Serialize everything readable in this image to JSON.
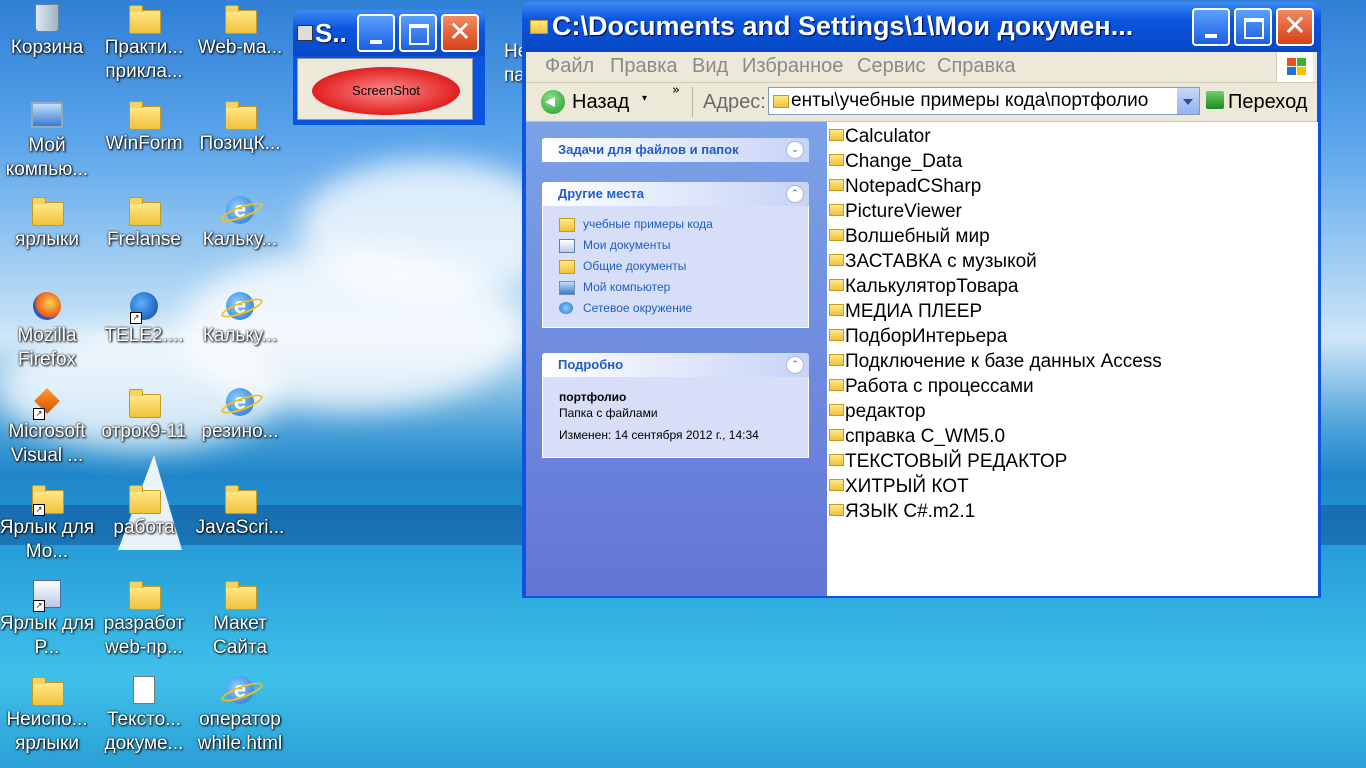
{
  "desktop": {
    "icons": [
      {
        "label": "Корзина",
        "icon": "recycle-bin-icon"
      },
      {
        "label": "Практи... прикла...",
        "icon": "folder-icon"
      },
      {
        "label": "Web-ма...",
        "icon": "folder-icon"
      },
      {
        "label": "Мой компью...",
        "icon": "my-computer-icon"
      },
      {
        "label": "WinForm",
        "icon": "folder-icon"
      },
      {
        "label": "ПозицК...",
        "icon": "folder-icon"
      },
      {
        "label": "ярлыки",
        "icon": "folder-icon"
      },
      {
        "label": "Frelanse",
        "icon": "folder-icon"
      },
      {
        "label": "Кальку...",
        "icon": "internet-explorer-icon"
      },
      {
        "label": "Mozilla Firefox",
        "icon": "firefox-icon"
      },
      {
        "label": "TELE2....",
        "icon": "tele2-icon"
      },
      {
        "label": "Кальку...",
        "icon": "internet-explorer-icon"
      },
      {
        "label": "Microsoft Visual ...",
        "icon": "visual-studio-icon"
      },
      {
        "label": "отрок9-11",
        "icon": "folder-icon"
      },
      {
        "label": "резино...",
        "icon": "internet-explorer-icon"
      },
      {
        "label": "Ярлык для Мо...",
        "icon": "folder-shortcut-icon"
      },
      {
        "label": "работа",
        "icon": "folder-icon"
      },
      {
        "label": "JavaScri...",
        "icon": "folder-icon"
      },
      {
        "label": "Ярлык для Р...",
        "icon": "setup-shortcut-icon"
      },
      {
        "label": "разработ web-пр...",
        "icon": "folder-icon"
      },
      {
        "label": "Макет Сайта",
        "icon": "folder-icon"
      },
      {
        "label": "Неиспо... ярлыки",
        "icon": "folder-icon"
      },
      {
        "label": "Тексто... докуме...",
        "icon": "text-document-icon"
      },
      {
        "label": "оператор while.html",
        "icon": "internet-explorer-icon"
      }
    ],
    "partial_label": "Не па"
  },
  "screenshot_app": {
    "title": "S..",
    "button_label": "ScreenShot"
  },
  "explorer": {
    "title": "C:\\Documents and Settings\\1\\Мои докумен...",
    "menu": [
      "Файл",
      "Правка",
      "Вид",
      "Избранное",
      "Сервис",
      "Справка"
    ],
    "toolbar": {
      "back_label": "Назад",
      "address_label": "Адрес:",
      "address_value": "енты\\учебные примеры кода\\портфолио",
      "go_label": "Переход"
    },
    "tasks_panel": {
      "title": "Задачи для файлов и папок"
    },
    "other_places": {
      "title": "Другие места",
      "links": [
        {
          "label": "учебные примеры кода",
          "icon": "folder-icon"
        },
        {
          "label": "Мои документы",
          "icon": "my-documents-icon"
        },
        {
          "label": "Общие документы",
          "icon": "folder-icon"
        },
        {
          "label": "Мой компьютер",
          "icon": "my-computer-icon"
        },
        {
          "label": "Сетевое окружение",
          "icon": "network-icon"
        }
      ]
    },
    "details": {
      "title": "Подробно",
      "name": "портфолио",
      "type": "Папка с файлами",
      "modified": "Изменен: 14 сентября 2012 г., 14:34"
    },
    "files": [
      "Calculator",
      "Change_Data",
      "NotepadCSharp",
      "PictureViewer",
      "Волшебный мир",
      "ЗАСТАВКА с музыкой",
      "КалькуляторТовара",
      "МЕДИА ПЛЕЕР",
      "ПодборИнтерьера",
      "Подключение к базе данных Access",
      "Работа с процессами",
      "редактор",
      "справка C_WM5.0",
      "ТЕКСТОВЫЙ РЕДАКТОР",
      "ХИТРЫЙ КОТ",
      "ЯЗЫК C#.m2.1"
    ]
  }
}
